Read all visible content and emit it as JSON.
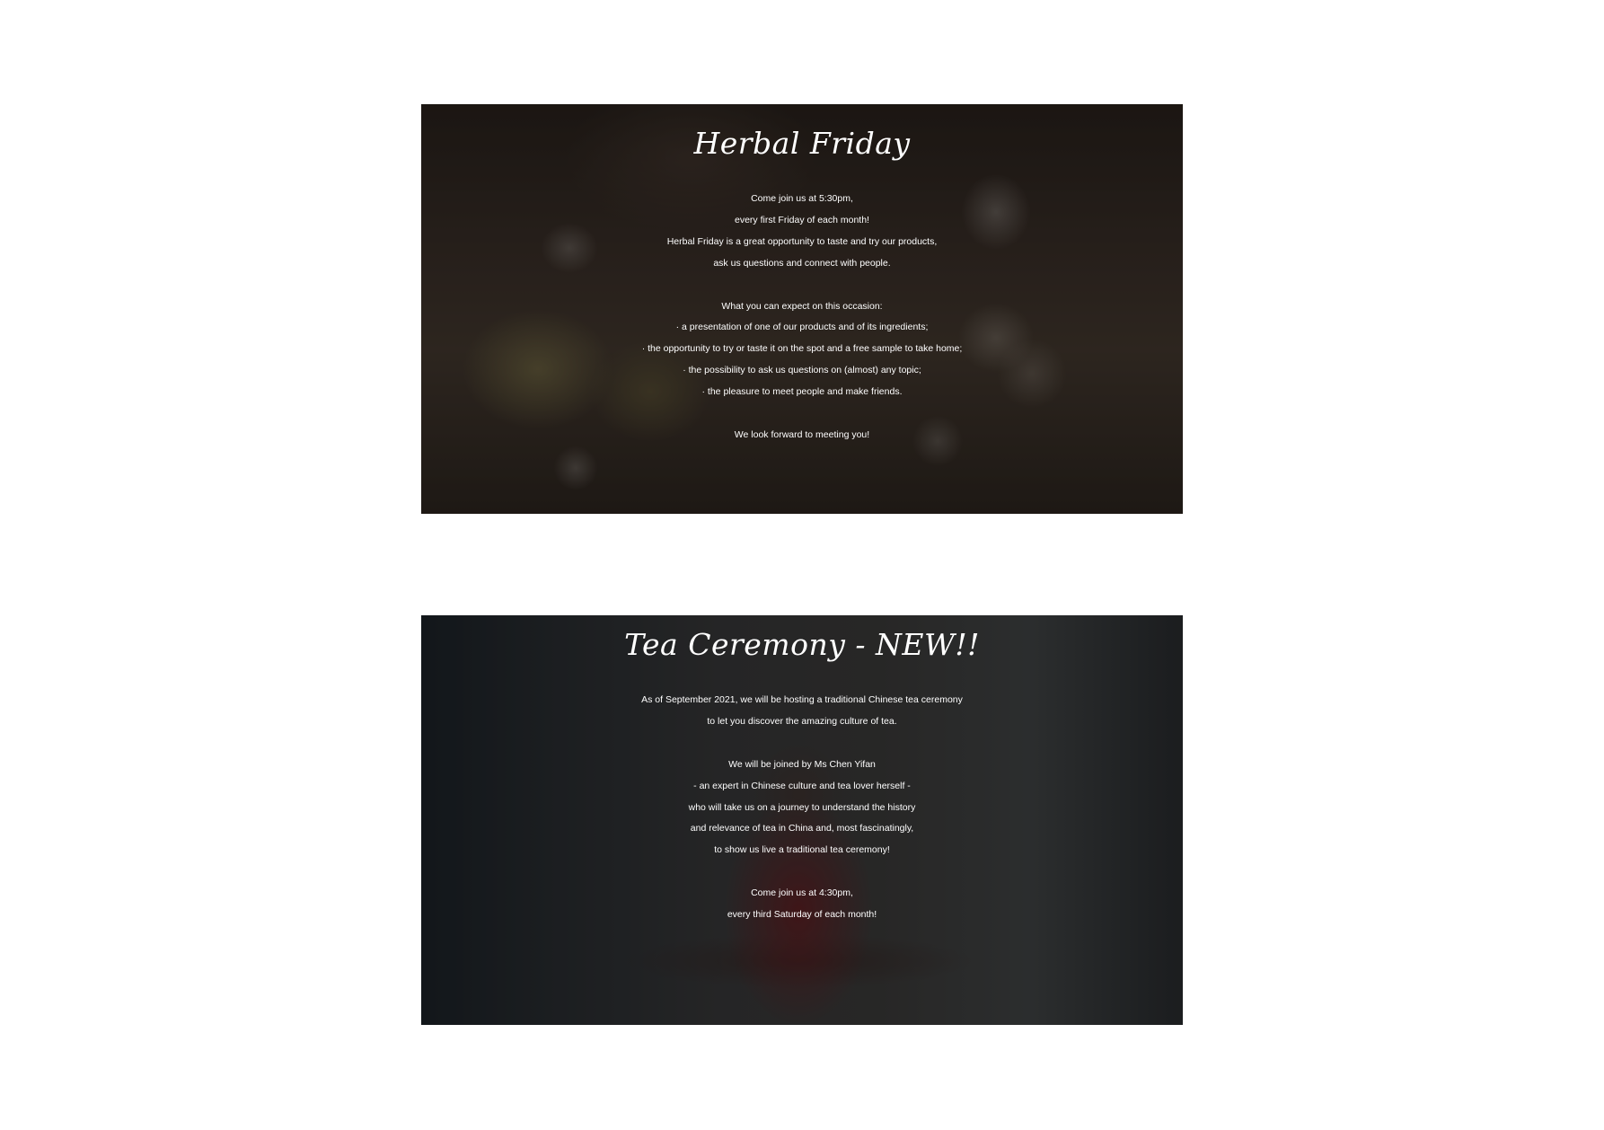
{
  "events": [
    {
      "title": "Herbal Friday",
      "lines": [
        "Come join us at 5:30pm,",
        "every first Friday of each month!",
        "Herbal Friday is a great opportunity to taste and try our products,",
        "ask us questions and connect with people.",
        "",
        "What you can expect on this occasion:",
        "· a presentation of one of our products and of its ingredients;",
        "· the opportunity to try or taste it on the spot and a free sample to take home;",
        "· the possibility to ask us questions on (almost) any topic;",
        "· the pleasure to meet people and make friends.",
        "",
        "We look forward to meeting you!"
      ]
    },
    {
      "title": "Tea Ceremony - NEW!!",
      "lines": [
        "As of September 2021, we will be hosting a traditional Chinese tea ceremony",
        "to let you discover the amazing culture of tea.",
        "",
        "We will be joined by Ms Chen Yifan",
        "- an expert in Chinese culture and tea lover herself -",
        "who will take us on a journey to understand the history",
        "and relevance of tea in China and, most fascinatingly,",
        "to show us live a traditional tea ceremony!",
        "",
        "Come join us at 4:30pm,",
        "every third Saturday of each month!"
      ]
    }
  ]
}
